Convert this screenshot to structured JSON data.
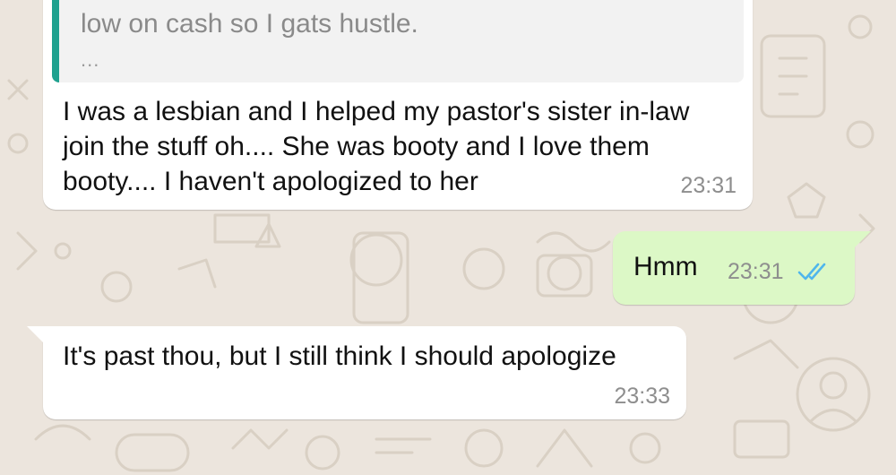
{
  "chat": {
    "messages": [
      {
        "direction": "incoming",
        "quoted": {
          "text": "low on cash so I gats hustle.",
          "more": "..."
        },
        "text": "I was a lesbian and I helped my pastor's sister in-law join the stuff oh.... She was booty and I love them booty.... I haven't apologized to her",
        "time": "23:31"
      },
      {
        "direction": "outgoing",
        "text": "Hmm",
        "time": "23:31",
        "status_icon": "double-check-icon",
        "status": "read"
      },
      {
        "direction": "incoming",
        "text": "It's past thou, but I still think I should apologize",
        "time": "23:33"
      }
    ]
  },
  "colors": {
    "background": "#ece5dd",
    "incoming_bubble": "#ffffff",
    "outgoing_bubble": "#dcf8c6",
    "quote_accent": "#1fa18f",
    "read_ticks": "#4fb6ec"
  }
}
